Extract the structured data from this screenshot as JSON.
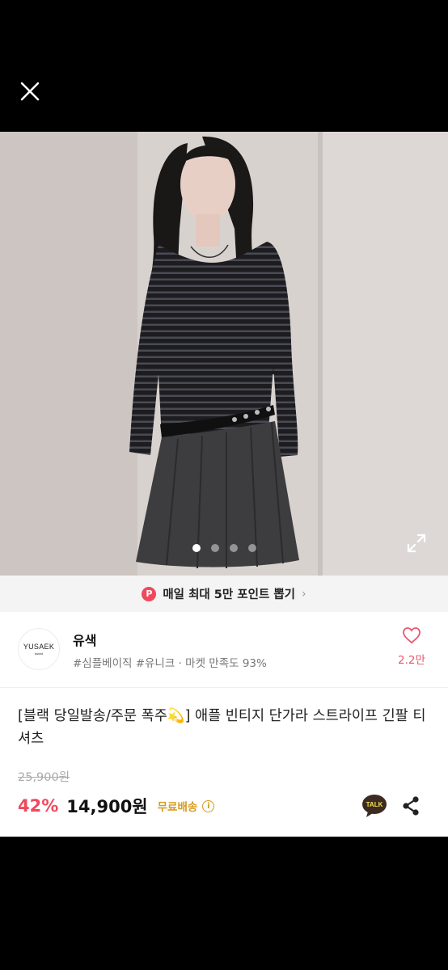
{
  "header": {
    "close_icon": "close-icon"
  },
  "gallery": {
    "image": "model wearing black striped long-sleeve tee with grey pleated skirt",
    "page_count": 4,
    "active_page": 1,
    "expand_icon": "expand-icon"
  },
  "promo": {
    "badge": "P",
    "text": "매일 최대 5만 포인트 뽑기",
    "chevron": "›"
  },
  "store": {
    "logo_text": "YUSAEK",
    "logo_subtext": "island",
    "name": "유색",
    "tags": "#심플베이직 #유니크 · 마켓 만족도 93%",
    "like_count": "2.2만"
  },
  "product": {
    "title": "[블랙 당일발송/주문 폭주💫] 애플 빈티지 단가라 스트라이프 긴팔 티셔츠",
    "original_price": "25,900원",
    "discount": "42%",
    "price": "14,900원",
    "shipping": "무료배송",
    "info_icon": "i",
    "talk_label": "TALK"
  },
  "colors": {
    "accent": "#f0495e",
    "shipping": "#d59a1e",
    "talk": "#3b2b22"
  }
}
